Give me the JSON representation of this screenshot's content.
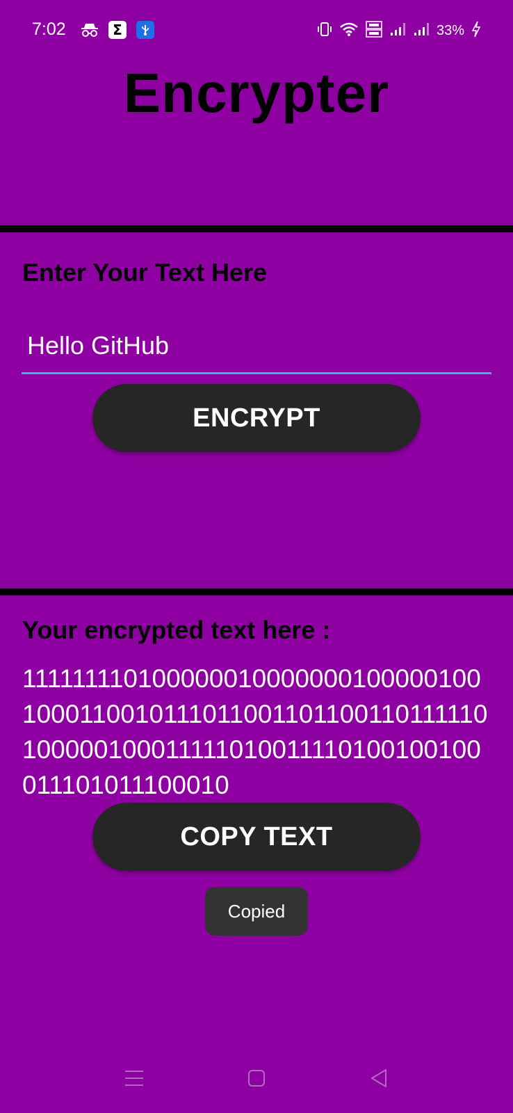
{
  "status_bar": {
    "time": "7:02",
    "battery": "33%",
    "icons": [
      "incognito-icon",
      "sigma-app-icon",
      "usb-icon",
      "vibrate-icon",
      "wifi-icon",
      "volte-icon",
      "signal-icon",
      "signal-icon-2",
      "charging-icon"
    ]
  },
  "app": {
    "title": "Encrypter"
  },
  "input_section": {
    "label": "Enter Your Text Here",
    "value": "Hello GitHub",
    "button_label": "ENCRYPT"
  },
  "output_section": {
    "label": "Your encrypted text here :",
    "value": "1111111101000000100000001000001001000110010111011001101100110111110100000100011111010011110100100100011101011100010",
    "button_label": "COPY TEXT"
  },
  "toast": {
    "message": "Copied"
  },
  "nav_bar": {
    "icons": [
      "menu-icon",
      "home-icon",
      "back-icon"
    ]
  },
  "colors": {
    "background": "#8f00a3",
    "button": "#262626",
    "input_underline": "#33b5e5",
    "divider": "#000000"
  }
}
